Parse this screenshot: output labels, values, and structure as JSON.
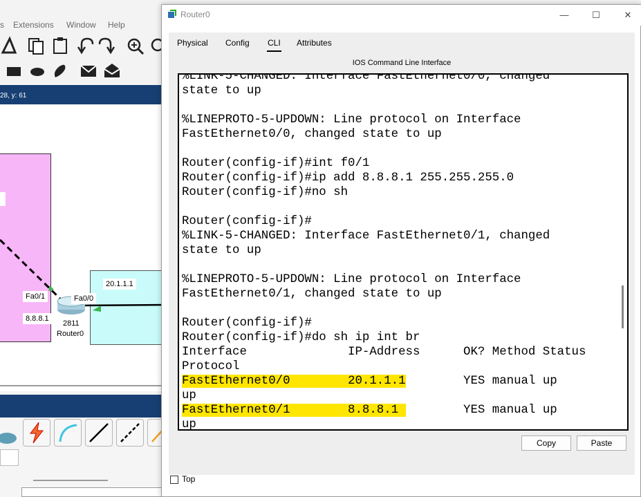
{
  "background_app": {
    "menu": [
      "s",
      "Extensions",
      "Window",
      "Help"
    ],
    "coordinates": "28, y: 61",
    "topology": {
      "pink_label": "",
      "cyan_ip": "20.1.1.1",
      "fa01_label": "Fa0/1",
      "fa00_label": "Fa0/0",
      "ip_label": "8.8.8.1",
      "router_model": "2811",
      "router_name": "Router0"
    },
    "colors": {
      "toolbar_dark": "#173f73",
      "pink": "#f7b6f7",
      "cyan": "#c9fbfb"
    }
  },
  "window": {
    "title": "Router0",
    "minimize": "—",
    "maximize": "☐",
    "close": "✕",
    "tabs": [
      "Physical",
      "Config",
      "CLI",
      "Attributes"
    ],
    "active_tab": "CLI",
    "cli_header": "IOS Command Line Interface",
    "terminal_lines": [
      "%LINK-5-CHANGED: Interface FastEthernet0/0, changed",
      "state to up",
      "",
      "%LINEPROTO-5-UPDOWN: Line protocol on Interface",
      "FastEthernet0/0, changed state to up",
      "",
      "Router(config-if)#int f0/1",
      "Router(config-if)#ip add 8.8.8.1 255.255.255.0",
      "Router(config-if)#no sh",
      "",
      "Router(config-if)#",
      "%LINK-5-CHANGED: Interface FastEthernet0/1, changed",
      "state to up",
      "",
      "%LINEPROTO-5-UPDOWN: Line protocol on Interface",
      "FastEthernet0/1, changed state to up",
      "",
      "Router(config-if)#",
      "Router(config-if)#do sh ip int br",
      "Interface              IP-Address      OK? Method Status",
      "Protocol"
    ],
    "highlight_rows": [
      {
        "highlighted": "FastEthernet0/0        20.1.1.1",
        "rest": "        YES manual up",
        "next": "up"
      },
      {
        "highlighted": "FastEthernet0/1        8.8.8.1 ",
        "rest": "        YES manual up",
        "next": "up"
      }
    ],
    "copy_button": "Copy",
    "paste_button": "Paste",
    "top_checkbox_label": "Top",
    "top_checked": false,
    "highlight_color": "#ffe600"
  }
}
